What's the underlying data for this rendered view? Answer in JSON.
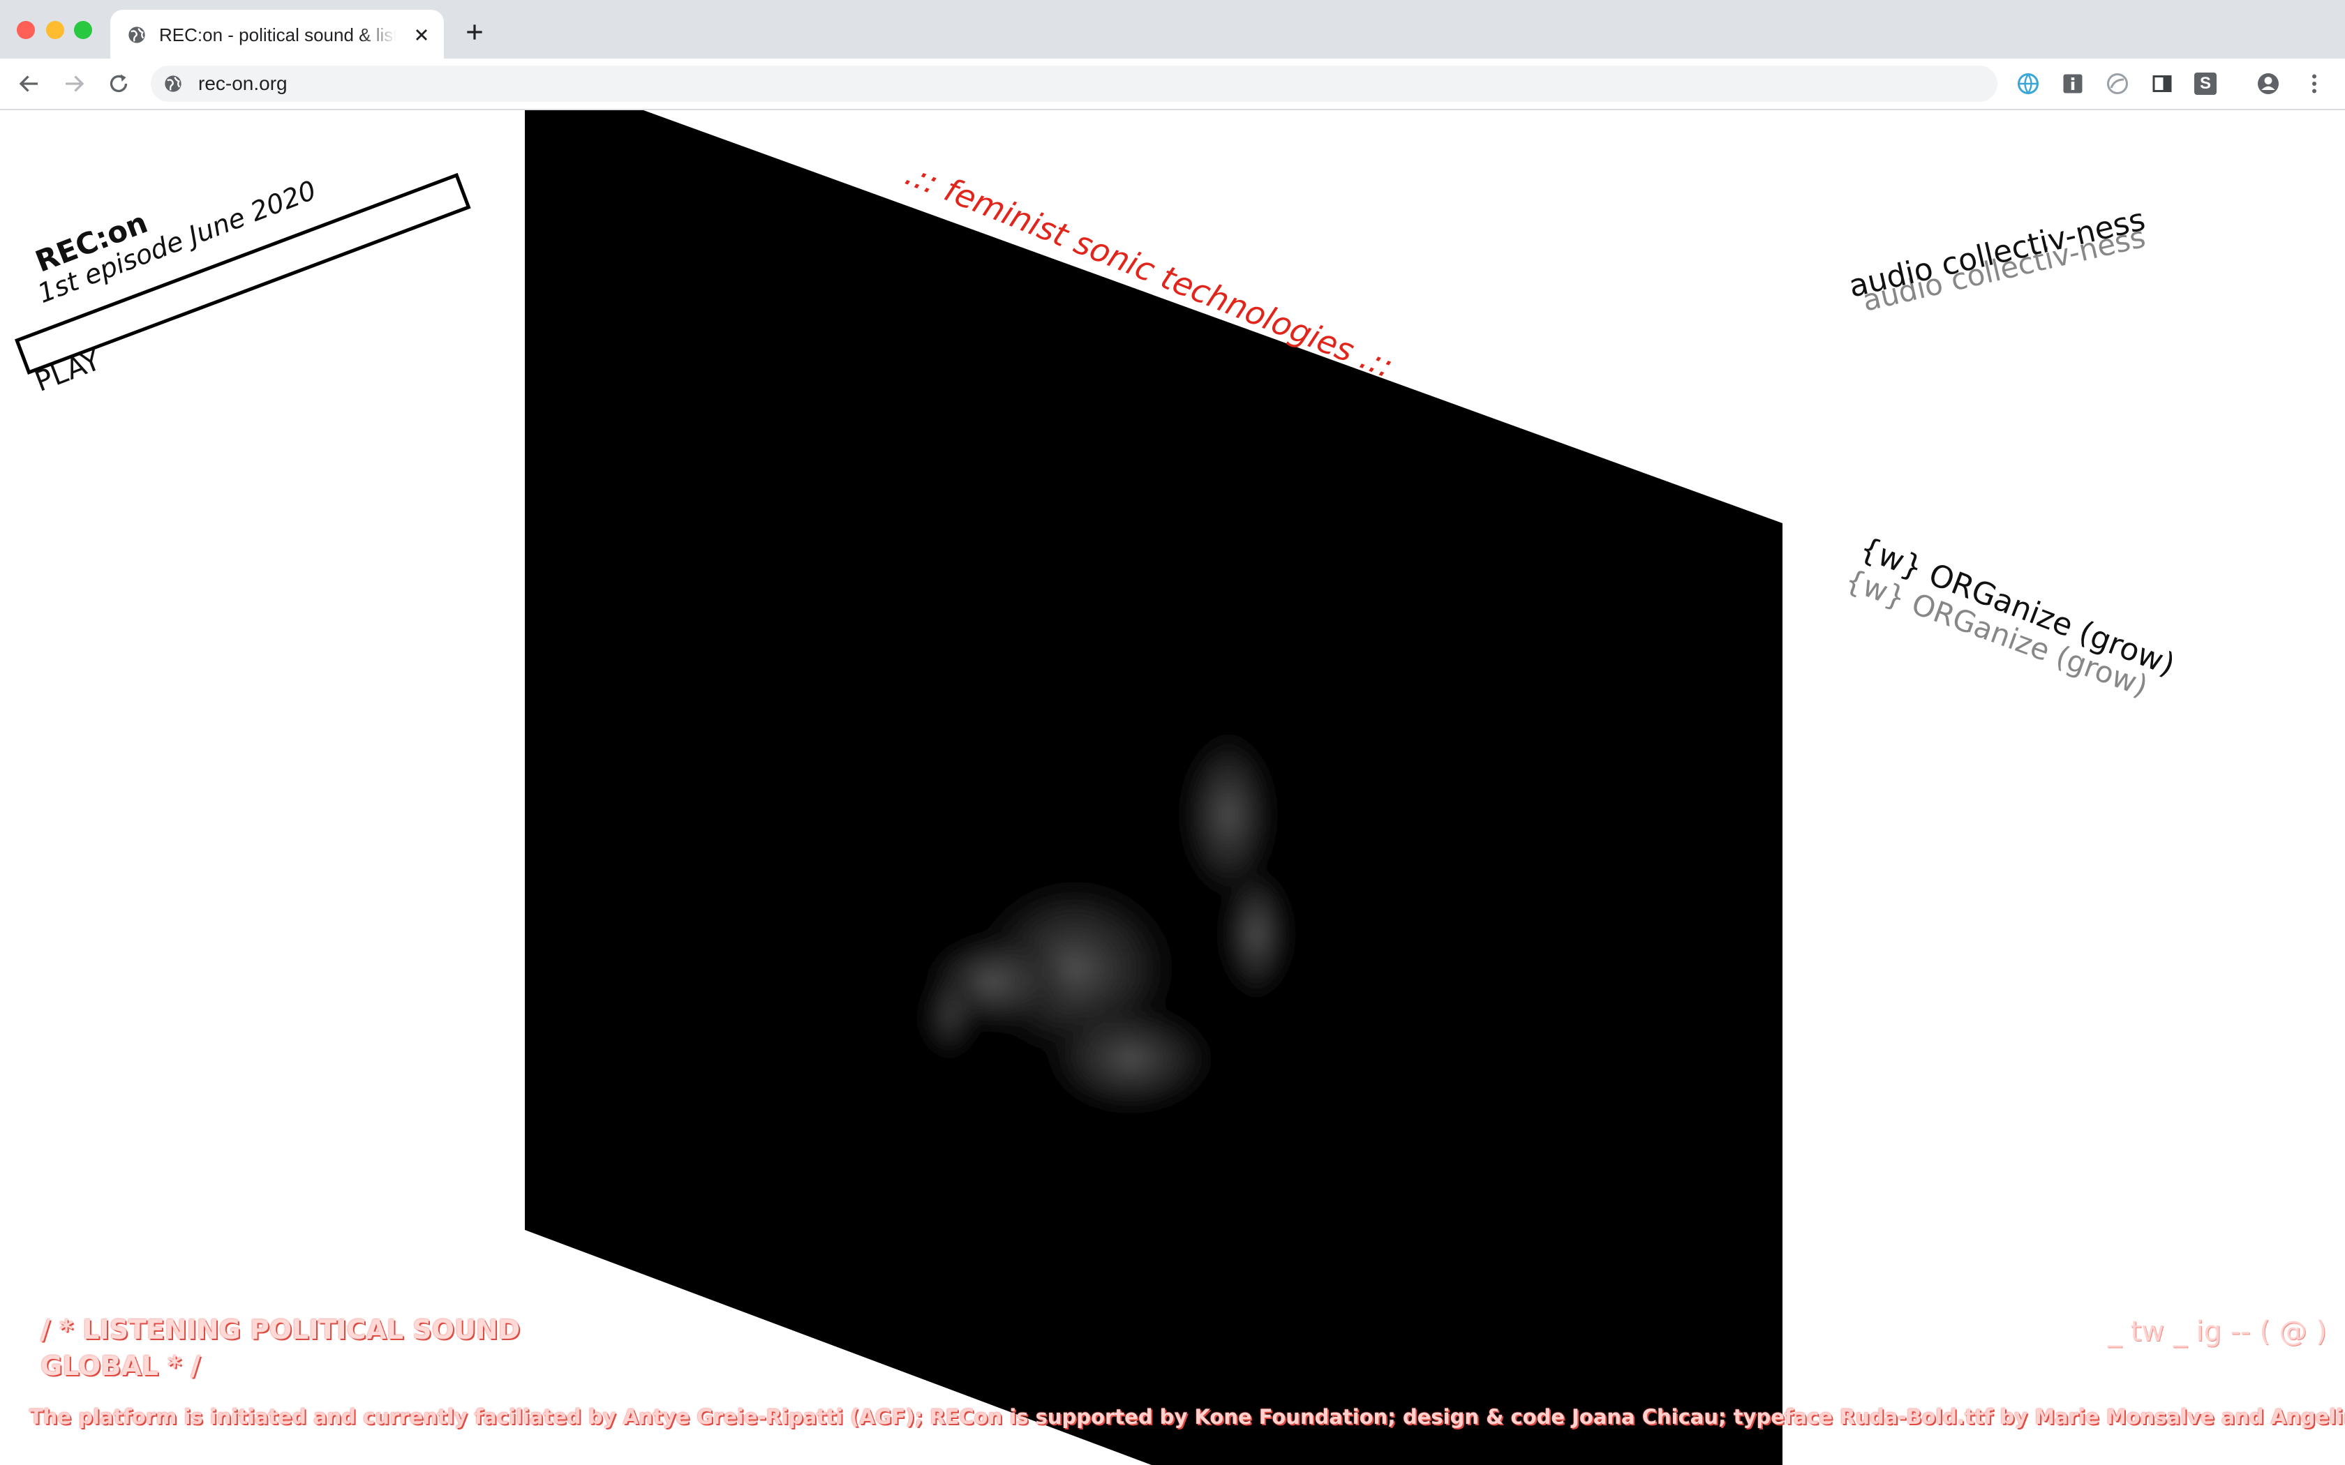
{
  "browser": {
    "tab_title": "REC:on - political sound & listening",
    "url": "rec-on.org",
    "extension_s_label": "S"
  },
  "page": {
    "site_title": "REC:on",
    "episode": "1st episode June 2020",
    "play_label": "PLAY",
    "tagline": ".:: feminist sonic technologies .::",
    "link_collectiv": "audio collectiv-ness",
    "link_organize": "{w} ORGanize (grow)",
    "listening_line1": "/ * LISTENING POLITICAL SOUND",
    "listening_line2": "GLOBAL * /",
    "social": "_ tw _ ig -- ( @ )",
    "footer": "The platform is initiated and currently faciliated by Antye Greie-Ripatti (AGF); RECon is supported by Kone Foundation; design & code Joana Chicau; typeface Ruda-Bold.ttf by Marie Monsalve and Angelina Sanchez."
  },
  "colors": {
    "accent_red": "#e1251b",
    "panel": "#000000",
    "chrome_bg": "#dee1e6"
  },
  "icons": {
    "tab_favicon": "globe-icon",
    "site_info": "globe-icon",
    "extensions": [
      "vpn-icon",
      "info-icon",
      "speed-icon",
      "reader-icon",
      "s-icon",
      "profile-icon",
      "menu-dots-icon"
    ]
  }
}
